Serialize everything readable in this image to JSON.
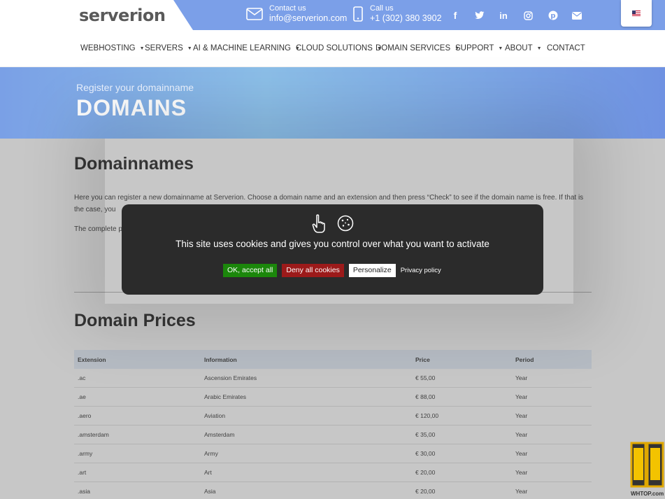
{
  "brand": {
    "logo": "serverion"
  },
  "topbar": {
    "contact_label": "Contact us",
    "contact_email": "info@serverion.com",
    "call_label": "Call us",
    "call_number": "+1 (302) 380 3902",
    "social": [
      "facebook-icon",
      "twitter-icon",
      "linkedin-icon",
      "instagram-icon",
      "pinterest-icon",
      "mail-icon"
    ],
    "language_flag": "us-flag"
  },
  "nav": {
    "items": [
      {
        "label": "WEBHOSTING",
        "dropdown": true
      },
      {
        "label": "SERVERS",
        "dropdown": true
      },
      {
        "label": "AI & MACHINE LEARNING",
        "dropdown": true
      },
      {
        "label": "CLOUD SOLUTIONS",
        "dropdown": true
      },
      {
        "label": "DOMAIN SERVICES",
        "dropdown": true
      },
      {
        "label": "SUPPORT",
        "dropdown": true
      },
      {
        "label": "ABOUT",
        "dropdown": true
      },
      {
        "label": "CONTACT",
        "dropdown": false
      }
    ]
  },
  "hero": {
    "subtitle": "Register your domainname",
    "title": "DOMAINS"
  },
  "main": {
    "heading1": "Domainnames",
    "para1": "Here you can register a new domainname at Serverion.  Choose a domain name and an extension and then press “Check” to see if the domain name is free. If that is the case, you",
    "para2": "The complete p",
    "heading2": "Domain Prices",
    "table": {
      "headers": [
        "Extension",
        "Information",
        "Price",
        "Period"
      ],
      "rows": [
        [
          ".ac",
          "Ascension Emirates",
          "€ 55,00",
          "Year"
        ],
        [
          ".ae",
          "Arabic Emirates",
          "€ 88,00",
          "Year"
        ],
        [
          ".aero",
          "Aviation",
          "€ 120,00",
          "Year"
        ],
        [
          ".amsterdam",
          "Amsterdam",
          "€ 35,00",
          "Year"
        ],
        [
          ".army",
          "Army",
          "€ 30,00",
          "Year"
        ],
        [
          ".art",
          "Art",
          "€ 20,00",
          "Year"
        ],
        [
          ".asia",
          "Asia",
          "€ 20,00",
          "Year"
        ]
      ]
    }
  },
  "cookie": {
    "message": "This site uses cookies and gives you control over what you want to activate",
    "accept_all": "OK, accept all",
    "deny_all": "Deny all cookies",
    "personalize": "Personalize",
    "privacy": "Privacy policy",
    "colors": {
      "accept": "#1b870b",
      "deny": "#9c1a1a"
    }
  },
  "watermark": {
    "text": "WHTOP.com"
  },
  "colors": {
    "accent": "#7b9fe8",
    "hero": "#8cbfe8"
  }
}
